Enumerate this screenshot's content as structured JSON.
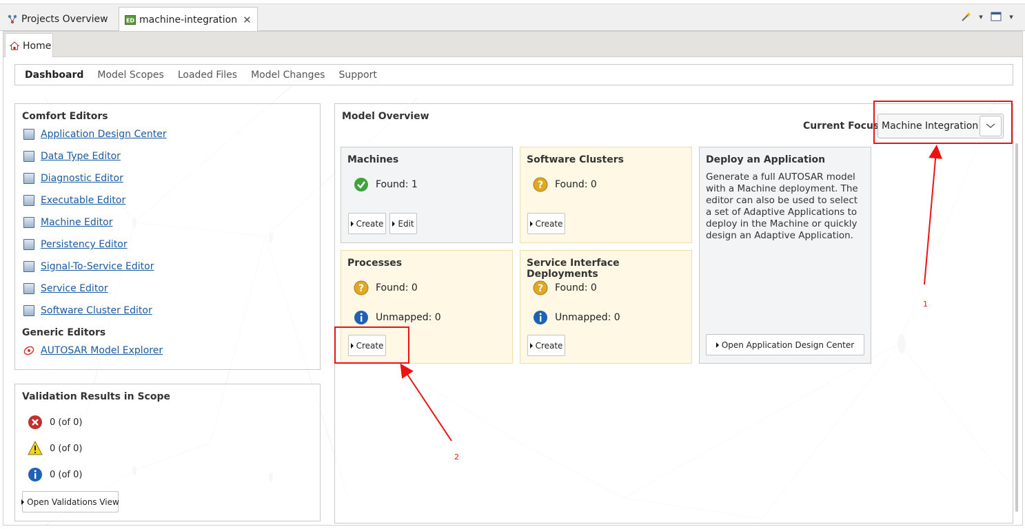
{
  "tabs": [
    {
      "label": "Projects Overview",
      "icon": "project-tree-icon"
    },
    {
      "label": "machine-integration",
      "icon": "editor-ed-icon",
      "closable": true
    }
  ],
  "home_tab": {
    "label": "Home",
    "icon": "home-icon"
  },
  "nav": [
    "Dashboard",
    "Model Scopes",
    "Loaded Files",
    "Model Changes",
    "Support"
  ],
  "comfort": {
    "title": "Comfort Editors",
    "editors": [
      "Application Design Center",
      "Data Type Editor",
      "Diagnostic Editor",
      "Executable Editor",
      "Machine Editor",
      "Persistency Editor",
      "Signal-To-Service Editor",
      "Service Editor",
      "Software Cluster Editor"
    ],
    "generic_title": "Generic Editors",
    "generic_editors": [
      "AUTOSAR Model Explorer"
    ]
  },
  "validation": {
    "title": "Validation Results in Scope",
    "errors": "0 (of 0)",
    "warnings": "0 (of 0)",
    "infos": "0 (of 0)",
    "button": "Open Validations View"
  },
  "overview": {
    "title": "Model Overview",
    "focus_label": "Current Focus:",
    "focus_value": "Machine Integration",
    "machines": {
      "title": "Machines",
      "found": "Found: 1",
      "create": "Create",
      "edit": "Edit"
    },
    "clusters": {
      "title": "Software Clusters",
      "found": "Found: 0",
      "create": "Create"
    },
    "processes": {
      "title": "Processes",
      "found": "Found: 0",
      "unmapped": "Unmapped: 0",
      "create": "Create"
    },
    "sid": {
      "title": "Service Interface Deployments",
      "found": "Found: 0",
      "unmapped": "Unmapped: 0",
      "create": "Create"
    },
    "deploy": {
      "title": "Deploy an Application",
      "description": "Generate a full AUTOSAR model with a Machine deployment. The editor can also be used to select a set of Adaptive Applications to deploy in the Machine or quickly design an Adaptive Application.",
      "button": "Open Application Design Center"
    }
  },
  "annotations": [
    "1",
    "2"
  ],
  "colors": {
    "accent_link": "#1a5aa0",
    "annotation_red": "#ee1111",
    "card_yellow": "#fef8e4"
  }
}
